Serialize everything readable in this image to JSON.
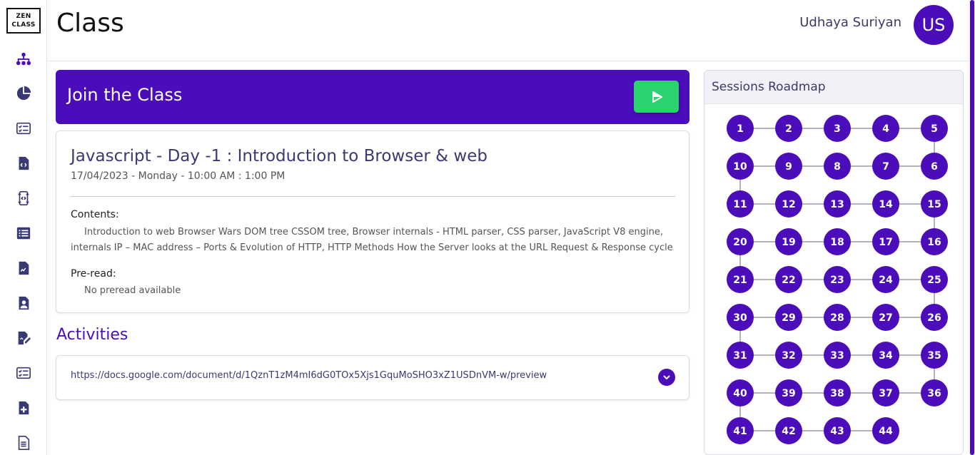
{
  "sidebar": {
    "logo_line1": "ZEN",
    "logo_line2": "CLASS",
    "icons": [
      {
        "name": "class-icon"
      },
      {
        "name": "dashboard-icon"
      },
      {
        "name": "tasks-icon"
      },
      {
        "name": "webcode-icon"
      },
      {
        "name": "capstone-icon"
      },
      {
        "name": "queries-icon"
      },
      {
        "name": "requirements-icon"
      },
      {
        "name": "portfolio-icon"
      },
      {
        "name": "application-icon"
      },
      {
        "name": "interview-tasks-icon"
      },
      {
        "name": "leave-icon"
      },
      {
        "name": "certificate-icon"
      }
    ],
    "accent": "#4b0dba"
  },
  "header": {
    "title": "Class",
    "user_name": "Udhaya Suriyan",
    "avatar_initials": "US"
  },
  "join": {
    "title": "Join the Class"
  },
  "class_detail": {
    "title": "Javascript - Day -1 : Introduction to Browser & web",
    "time": "17/04/2023 - Monday - 10:00 AM : 1:00 PM",
    "contents_label": "Contents:",
    "contents_text": "Introduction to web Browser Wars DOM tree CSSOM tree, Browser internals - HTML parser, CSS parser, JavaScript V8 engine, internals IP – MAC address – Ports & Evolution of HTTP, HTTP Methods How the Server looks at the URL Request & Response cycle",
    "preread_label": "Pre-read:",
    "preread_text": "No preread available"
  },
  "activities": {
    "title": "Activities",
    "items": [
      {
        "link": "https://docs.google.com/document/d/1QznT1zM4mI6dG0TOx5Xjs1GquMoSHO3xZ1USDnVM-w/preview"
      }
    ]
  },
  "roadmap": {
    "title": "Sessions Roadmap",
    "rows": [
      [
        "1",
        "2",
        "3",
        "4",
        "5"
      ],
      [
        "10",
        "9",
        "8",
        "7",
        "6"
      ],
      [
        "11",
        "12",
        "13",
        "14",
        "15"
      ],
      [
        "20",
        "19",
        "18",
        "17",
        "16"
      ],
      [
        "21",
        "22",
        "23",
        "24",
        "25"
      ],
      [
        "30",
        "29",
        "28",
        "27",
        "26"
      ],
      [
        "31",
        "32",
        "33",
        "34",
        "35"
      ],
      [
        "40",
        "39",
        "38",
        "37",
        "36"
      ],
      [
        "41",
        "42",
        "43",
        "44"
      ]
    ],
    "node_color": "#4b0dba"
  },
  "colors": {
    "primary": "#4b0dba",
    "play_green": "#2bd36f"
  }
}
